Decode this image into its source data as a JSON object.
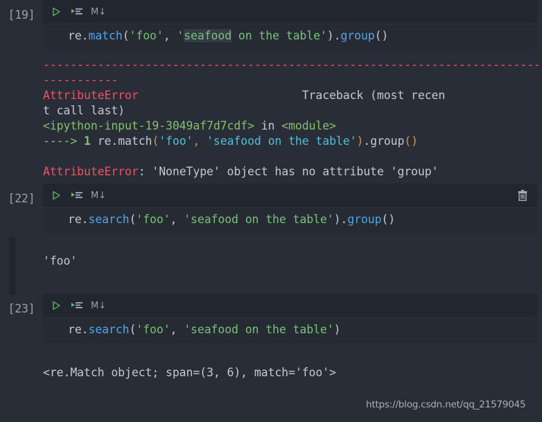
{
  "theme": {
    "page_background": "#292d38",
    "cell_background": "#262a33",
    "toolbar_background": "#22262f",
    "prompt_color": "#9aa1ad",
    "plain_text": "#c3c8d1",
    "function_color": "#4fa6ea",
    "string_color": "#76c379",
    "error_color": "#f4515f",
    "traceback_green": "#86c06a",
    "traceback_orange": "#d9904a",
    "traceback_cyan": "#4fc1d8",
    "selection_highlight": "#353b48",
    "output_indicator": "#21252e"
  },
  "toolbar": {
    "run_icon": "play-icon",
    "run_advance_icon": "run-and-advance-icon",
    "markdown_label": "M↓",
    "delete_icon": "trash-icon"
  },
  "cells": [
    {
      "prompt": "[19]",
      "has_delete": false,
      "code": {
        "tokens": [
          {
            "text": "re.",
            "type": "plain"
          },
          {
            "text": "match",
            "type": "func"
          },
          {
            "text": "(",
            "type": "punct"
          },
          {
            "text": "'foo'",
            "type": "string"
          },
          {
            "text": ", ",
            "type": "punct"
          },
          {
            "text": "'",
            "type": "string"
          },
          {
            "text": "seafood",
            "type": "string-selected"
          },
          {
            "text": " on the table'",
            "type": "string"
          },
          {
            "text": ").",
            "type": "punct"
          },
          {
            "text": "group",
            "type": "func"
          },
          {
            "text": "()",
            "type": "punct"
          }
        ],
        "plain": "re.match('foo', 'seafood on the table').group()"
      },
      "output": {
        "indicator": false,
        "lines": [
          {
            "type": "dashes",
            "text": "--------------------------------------------------------------------------"
          },
          {
            "type": "dashes",
            "text": "-----------"
          },
          {
            "type": "error_header",
            "error": "AttributeError",
            "traceback_first": "Traceback (most recen"
          },
          {
            "type": "plain",
            "text": "t call last)"
          },
          {
            "type": "frame",
            "location": "<ipython-input-19-3049af7d7cdf>",
            "in_word": " in ",
            "scope": "<module>"
          },
          {
            "type": "codeline",
            "arrow": "---->",
            "lineno": "1",
            "code": "re.match('foo', 'seafood on the table').group()"
          },
          {
            "type": "blank",
            "text": " "
          },
          {
            "type": "error_message",
            "error": "AttributeError",
            "message": ": 'NoneType' object has no attribute 'group'"
          }
        ]
      }
    },
    {
      "prompt": "[22]",
      "has_delete": true,
      "code": {
        "tokens": [
          {
            "text": "re.",
            "type": "plain"
          },
          {
            "text": "search",
            "type": "func"
          },
          {
            "text": "(",
            "type": "punct"
          },
          {
            "text": "'foo'",
            "type": "string"
          },
          {
            "text": ", ",
            "type": "punct"
          },
          {
            "text": "'seafood on the table'",
            "type": "string"
          },
          {
            "text": ").",
            "type": "punct"
          },
          {
            "text": "group",
            "type": "func"
          },
          {
            "text": "()",
            "type": "punct"
          }
        ],
        "plain": "re.search('foo', 'seafood on the table').group()"
      },
      "output": {
        "indicator": true,
        "lines": [
          {
            "type": "blank",
            "text": " "
          },
          {
            "type": "plain",
            "text": "'foo'"
          },
          {
            "type": "blank",
            "text": " "
          }
        ]
      }
    },
    {
      "prompt": "[23]",
      "has_delete": false,
      "code": {
        "tokens": [
          {
            "text": "re.",
            "type": "plain"
          },
          {
            "text": "search",
            "type": "func"
          },
          {
            "text": "(",
            "type": "punct"
          },
          {
            "text": "'foo'",
            "type": "string"
          },
          {
            "text": ", ",
            "type": "punct"
          },
          {
            "text": "'seafood on the table'",
            "type": "string"
          },
          {
            "text": ")",
            "type": "punct"
          }
        ],
        "plain": "re.search('foo', 'seafood on the table')"
      },
      "output": {
        "indicator": false,
        "lines": [
          {
            "type": "blank",
            "text": " "
          },
          {
            "type": "plain",
            "text": "<re.Match object; span=(3, 6), match='foo'>"
          }
        ]
      }
    }
  ],
  "watermark": {
    "text": "https://blog.csdn.net/qq_21579045"
  }
}
